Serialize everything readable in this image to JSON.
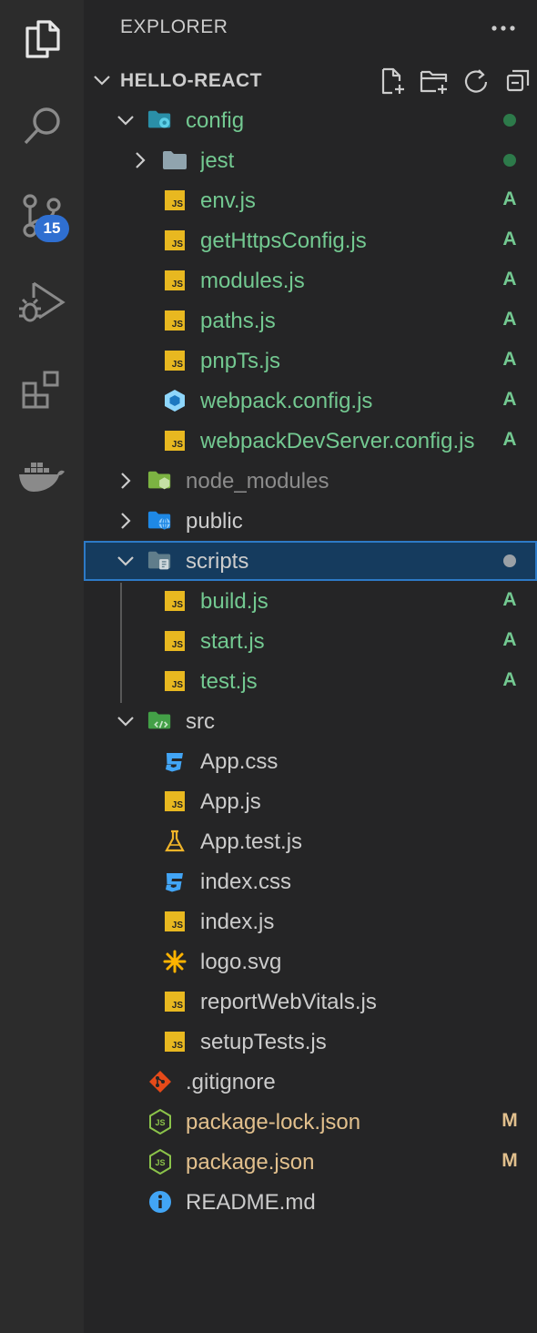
{
  "activity_bar": {
    "items": [
      {
        "name": "explorer-icon"
      },
      {
        "name": "search-icon"
      },
      {
        "name": "source-control-icon"
      },
      {
        "name": "run-debug-icon"
      },
      {
        "name": "extensions-icon"
      },
      {
        "name": "docker-icon"
      }
    ],
    "source_control_badge": "15"
  },
  "explorer": {
    "title": "EXPLORER",
    "more_actions_icon": "ellipsis-icon",
    "section_title": "HELLO-REACT",
    "section_actions": [
      "new-file-icon",
      "new-folder-icon",
      "refresh-icon",
      "collapse-all-icon"
    ]
  },
  "colors": {
    "activity_bg": "#2c2c2c",
    "sidebar_bg": "#252526",
    "added_green": "#73c991",
    "modified_gold": "#e2c08d",
    "default_text": "#cccccc",
    "ignored_gray": "#8c8c8c",
    "selection_bg": "#153b5e",
    "badge_blue": "#2f6fd1",
    "js_yellow": "#e8b820"
  },
  "tree": [
    {
      "label": "config",
      "depth": 1,
      "type": "folder",
      "chevron": "open",
      "icon": "folder-config-icon",
      "color": "green",
      "status": "",
      "dot": "#2d7a4a"
    },
    {
      "label": "jest",
      "depth": 2,
      "type": "folder",
      "chevron": "closed",
      "icon": "folder-icon",
      "color": "green",
      "status": "",
      "dot": "#2d7a4a"
    },
    {
      "label": "env.js",
      "depth": 2,
      "type": "file",
      "icon": "js-file-icon",
      "color": "green",
      "status": "A"
    },
    {
      "label": "getHttpsConfig.js",
      "depth": 2,
      "type": "file",
      "icon": "js-file-icon",
      "color": "green",
      "status": "A"
    },
    {
      "label": "modules.js",
      "depth": 2,
      "type": "file",
      "icon": "js-file-icon",
      "color": "green",
      "status": "A"
    },
    {
      "label": "paths.js",
      "depth": 2,
      "type": "file",
      "icon": "js-file-icon",
      "color": "green",
      "status": "A"
    },
    {
      "label": "pnpTs.js",
      "depth": 2,
      "type": "file",
      "icon": "js-file-icon",
      "color": "green",
      "status": "A"
    },
    {
      "label": "webpack.config.js",
      "depth": 2,
      "type": "file",
      "icon": "webpack-icon",
      "color": "green",
      "status": "A"
    },
    {
      "label": "webpackDevServer.config.js",
      "depth": 2,
      "type": "file",
      "icon": "js-file-icon",
      "color": "green",
      "status": "A"
    },
    {
      "label": "node_modules",
      "depth": 1,
      "type": "folder",
      "chevron": "closed",
      "icon": "folder-node-icon",
      "color": "gray",
      "status": ""
    },
    {
      "label": "public",
      "depth": 1,
      "type": "folder",
      "chevron": "closed",
      "icon": "folder-public-icon",
      "color": "default",
      "status": ""
    },
    {
      "label": "scripts",
      "depth": 1,
      "type": "folder",
      "chevron": "open",
      "icon": "folder-scripts-icon",
      "color": "default",
      "status": "",
      "dot": "#9aa0a6",
      "selected": true
    },
    {
      "label": "build.js",
      "depth": 2,
      "type": "file",
      "icon": "js-file-icon",
      "color": "green",
      "status": "A"
    },
    {
      "label": "start.js",
      "depth": 2,
      "type": "file",
      "icon": "js-file-icon",
      "color": "green",
      "status": "A"
    },
    {
      "label": "test.js",
      "depth": 2,
      "type": "file",
      "icon": "js-file-icon",
      "color": "green",
      "status": "A"
    },
    {
      "label": "src",
      "depth": 1,
      "type": "folder",
      "chevron": "open",
      "icon": "folder-src-icon",
      "color": "default",
      "status": ""
    },
    {
      "label": "App.css",
      "depth": 2,
      "type": "file",
      "icon": "css-file-icon",
      "color": "default",
      "status": ""
    },
    {
      "label": "App.js",
      "depth": 2,
      "type": "file",
      "icon": "js-file-icon",
      "color": "default",
      "status": ""
    },
    {
      "label": "App.test.js",
      "depth": 2,
      "type": "file",
      "icon": "test-flask-icon",
      "color": "default",
      "status": ""
    },
    {
      "label": "index.css",
      "depth": 2,
      "type": "file",
      "icon": "css-file-icon",
      "color": "default",
      "status": ""
    },
    {
      "label": "index.js",
      "depth": 2,
      "type": "file",
      "icon": "js-file-icon",
      "color": "default",
      "status": ""
    },
    {
      "label": "logo.svg",
      "depth": 2,
      "type": "file",
      "icon": "svg-file-icon",
      "color": "default",
      "status": ""
    },
    {
      "label": "reportWebVitals.js",
      "depth": 2,
      "type": "file",
      "icon": "js-file-icon",
      "color": "default",
      "status": ""
    },
    {
      "label": "setupTests.js",
      "depth": 2,
      "type": "file",
      "icon": "js-file-icon",
      "color": "default",
      "status": ""
    },
    {
      "label": ".gitignore",
      "depth": 1,
      "type": "file",
      "icon": "git-icon",
      "color": "default",
      "status": ""
    },
    {
      "label": "package-lock.json",
      "depth": 1,
      "type": "file",
      "icon": "node-json-icon",
      "color": "gold",
      "status": "M"
    },
    {
      "label": "package.json",
      "depth": 1,
      "type": "file",
      "icon": "node-json-icon",
      "color": "gold",
      "status": "M"
    },
    {
      "label": "README.md",
      "depth": 1,
      "type": "file",
      "icon": "info-icon",
      "color": "default",
      "status": ""
    }
  ]
}
